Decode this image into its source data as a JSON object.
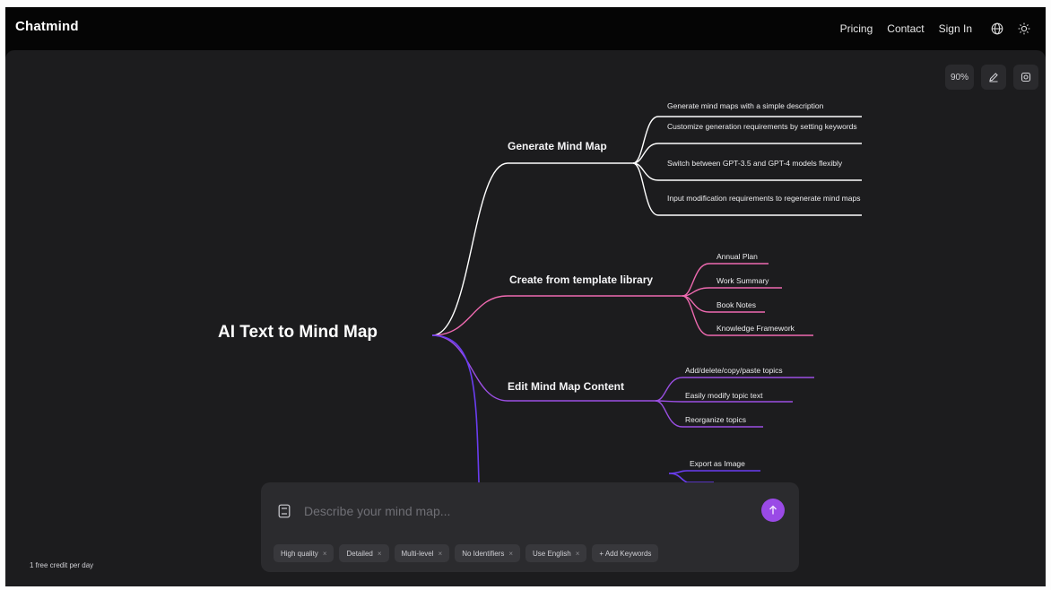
{
  "header": {
    "logo": "Chatmind",
    "nav": [
      {
        "label": "Pricing"
      },
      {
        "label": "Contact"
      },
      {
        "label": "Sign In"
      }
    ],
    "icons": [
      "globe-icon",
      "sun-icon"
    ]
  },
  "toolbar": {
    "zoom": "90%",
    "icons": [
      "edit-icon",
      "settings-icon"
    ]
  },
  "mindmap": {
    "root": "AI Text to Mind Map",
    "colors": {
      "branch1": "#ffffff",
      "branch2": "#ee6ab0",
      "branch3": "#9b4fe3",
      "branch4": "#6a3df0"
    },
    "branches": [
      {
        "label": "Generate Mind Map",
        "leaves": [
          "Generate mind maps with a simple description",
          "Customize generation requirements by setting keywords",
          "Switch between GPT-3.5 and GPT-4 models flexibly",
          "Input modification requirements to regenerate mind maps"
        ]
      },
      {
        "label": "Create from template library",
        "leaves": [
          "Annual Plan",
          "Work Summary",
          "Book Notes",
          "Knowledge Framework"
        ]
      },
      {
        "label": "Edit Mind Map Content",
        "leaves": [
          "Add/delete/copy/paste topics",
          "Easily modify topic text",
          "Reorganize topics"
        ]
      },
      {
        "label": "",
        "leaves": [
          "Export as Image"
        ]
      }
    ]
  },
  "prompt": {
    "placeholder": "Describe your mind map...",
    "chips": [
      {
        "label": "High quality"
      },
      {
        "label": "Detailed"
      },
      {
        "label": "Multi-level"
      },
      {
        "label": "No Identifiers"
      },
      {
        "label": "Use English"
      },
      {
        "label": "+ Add Keywords"
      }
    ]
  },
  "footer": {
    "credit": "1 free credit per day"
  }
}
